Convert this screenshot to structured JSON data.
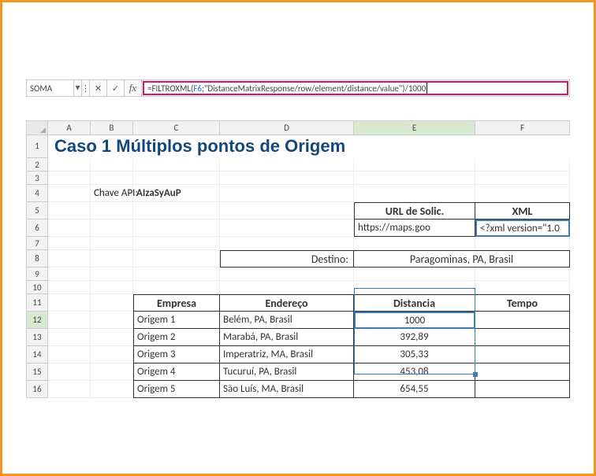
{
  "formula_bar": {
    "name_box": "SOMA",
    "cancel_icon": "✕",
    "enter_icon": "✓",
    "fx_label": "fx",
    "formula_prefix": "=FILTROXML(",
    "formula_ref": "F6",
    "formula_suffix": ";\"DistanceMatrixResponse/row/element/distance/value\")/1000"
  },
  "columns": [
    "A",
    "B",
    "C",
    "D",
    "E",
    "F"
  ],
  "active_column": "E",
  "rows_visible": [
    1,
    2,
    3,
    4,
    5,
    6,
    7,
    8,
    9,
    10,
    11,
    12,
    13,
    14,
    15,
    16
  ],
  "active_row": 12,
  "title": "Caso 1 Múltiplos pontos de Origem",
  "api_label": "Chave API:",
  "api_key": "AIzaSyAuP",
  "url_header": "URL de Solic.",
  "xml_header": "XML",
  "url_value": "https://maps.goo",
  "xml_value": "<?xml version=\"1.0",
  "destino_label": "Destino:",
  "destino_value": "Paragominas, PA, Brasil",
  "table": {
    "headers": {
      "empresa": "Empresa",
      "endereco": "Endereço",
      "distancia": "Distancia",
      "tempo": "Tempo"
    },
    "rows": [
      {
        "empresa": "Origem 1",
        "endereco": "Belém, PA, Brasil",
        "distancia": "1000",
        "tempo": ""
      },
      {
        "empresa": "Origem 2",
        "endereco": "Marabá, PA, Brasil",
        "distancia": "392,89",
        "tempo": ""
      },
      {
        "empresa": "Origem 3",
        "endereco": "Imperatriz, MA, Brasil",
        "distancia": "305,33",
        "tempo": ""
      },
      {
        "empresa": "Origem 4",
        "endereco": "Tucuruí, PA, Brasil",
        "distancia": "453,08",
        "tempo": ""
      },
      {
        "empresa": "Origem 5",
        "endereco": "São Luís, MA, Brasil",
        "distancia": "654,55",
        "tempo": ""
      }
    ]
  }
}
